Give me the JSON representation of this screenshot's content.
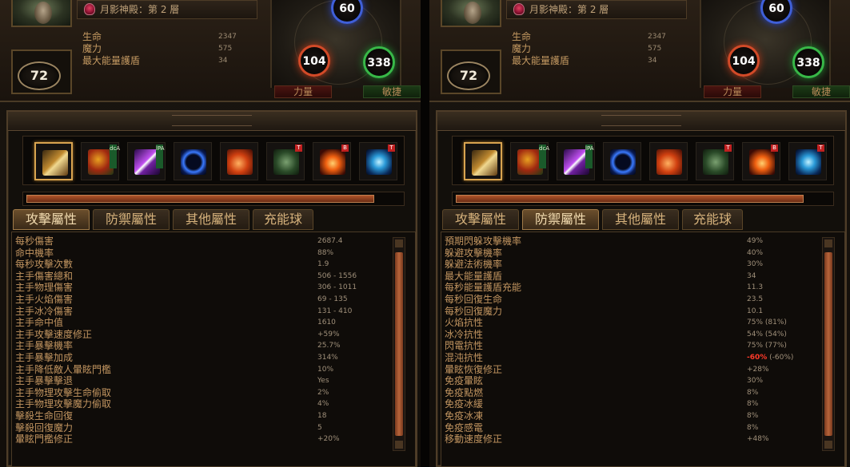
{
  "location": "月影神殿：第 2 層",
  "character": {
    "level": "72",
    "core": [
      {
        "label": "生命",
        "value": "2347"
      },
      {
        "label": "魔力",
        "value": "575"
      },
      {
        "label": "最大能量護盾",
        "value": "34"
      }
    ]
  },
  "attributes": {
    "int": "60",
    "str": "104",
    "dex": "338",
    "str_label": "力量",
    "dex_label": "敏捷"
  },
  "skills": [
    {
      "icon": "sword-icon",
      "selected": true
    },
    {
      "icon": "fire-rose-icon",
      "support_tag": "dcA"
    },
    {
      "icon": "lightning-icon",
      "support_tag": "lPA"
    },
    {
      "icon": "blue-ring-icon"
    },
    {
      "icon": "fire-fist-icon"
    },
    {
      "icon": "green-beast-icon",
      "tag": "T"
    },
    {
      "icon": "flame-burst-icon",
      "tag": "B"
    },
    {
      "icon": "frost-rune-icon",
      "tag": "T"
    }
  ],
  "xp_progress": 0.93,
  "tabs": [
    "攻擊屬性",
    "防禦屬性",
    "其他屬性",
    "充能球"
  ],
  "left": {
    "active_tab": 0,
    "stats": [
      {
        "label": "每秒傷害",
        "value": "2687.4"
      },
      {
        "label": "命中機率",
        "value": "88%"
      },
      {
        "label": "每秒攻擊次數",
        "value": "1.9"
      },
      {
        "label": "主手傷害總和",
        "value": "506 - 1556"
      },
      {
        "label": "主手物理傷害",
        "value": "306 - 1011"
      },
      {
        "label": "主手火焰傷害",
        "value": "69 - 135"
      },
      {
        "label": "主手冰冷傷害",
        "value": "131 - 410"
      },
      {
        "label": "主手命中值",
        "value": "1610"
      },
      {
        "label": "主手攻擊速度修正",
        "value": "+59%"
      },
      {
        "label": "主手暴擊機率",
        "value": "25.7%"
      },
      {
        "label": "主手暴擊加成",
        "value": "314%"
      },
      {
        "label": "主手降低敵人暈眩門檻",
        "value": "10%"
      },
      {
        "label": "主手暴擊擊退",
        "value": "Yes"
      },
      {
        "label": "主手物理攻擊生命偷取",
        "value": "2%"
      },
      {
        "label": "主手物理攻擊魔力偷取",
        "value": "4%"
      },
      {
        "label": "擊殺生命回復",
        "value": "18"
      },
      {
        "label": "擊殺回復魔力",
        "value": "5"
      },
      {
        "label": "暈眩門檻修正",
        "value": "+20%"
      }
    ]
  },
  "right": {
    "active_tab": 1,
    "stats": [
      {
        "label": "預期閃躲攻擊機率",
        "value": "49%"
      },
      {
        "label": "躲避攻擊機率",
        "value": "40%"
      },
      {
        "label": "躲避法術機率",
        "value": "30%"
      },
      {
        "label": "最大能量護盾",
        "value": "34"
      },
      {
        "label": "每秒能量護盾充能",
        "value": "11.3"
      },
      {
        "label": "每秒回復生命",
        "value": "23.5"
      },
      {
        "label": "每秒回復魔力",
        "value": "10.1"
      },
      {
        "label": "火焰抗性",
        "value": "75% (81%)"
      },
      {
        "label": "冰冷抗性",
        "value": "54% (54%)"
      },
      {
        "label": "閃電抗性",
        "value": "75% (77%)"
      },
      {
        "label": "混沌抗性",
        "value_neg": "-60%",
        "value": "(-60%)"
      },
      {
        "label": "暈眩恢復修正",
        "value": "+28%"
      },
      {
        "label": "免疫暈眩",
        "value": "30%"
      },
      {
        "label": "免疫點燃",
        "value": "8%"
      },
      {
        "label": "免疫冰緩",
        "value": "8%"
      },
      {
        "label": "免疫冰凍",
        "value": "8%"
      },
      {
        "label": "免疫感電",
        "value": "8%"
      },
      {
        "label": "移動速度修正",
        "value": "+48%"
      }
    ]
  },
  "colors": {
    "int_orb": "#3f5fd8",
    "str_orb": "#d24a28",
    "dex_orb": "#38b848",
    "negative": "#ff3a2a",
    "label": "#c29560"
  }
}
